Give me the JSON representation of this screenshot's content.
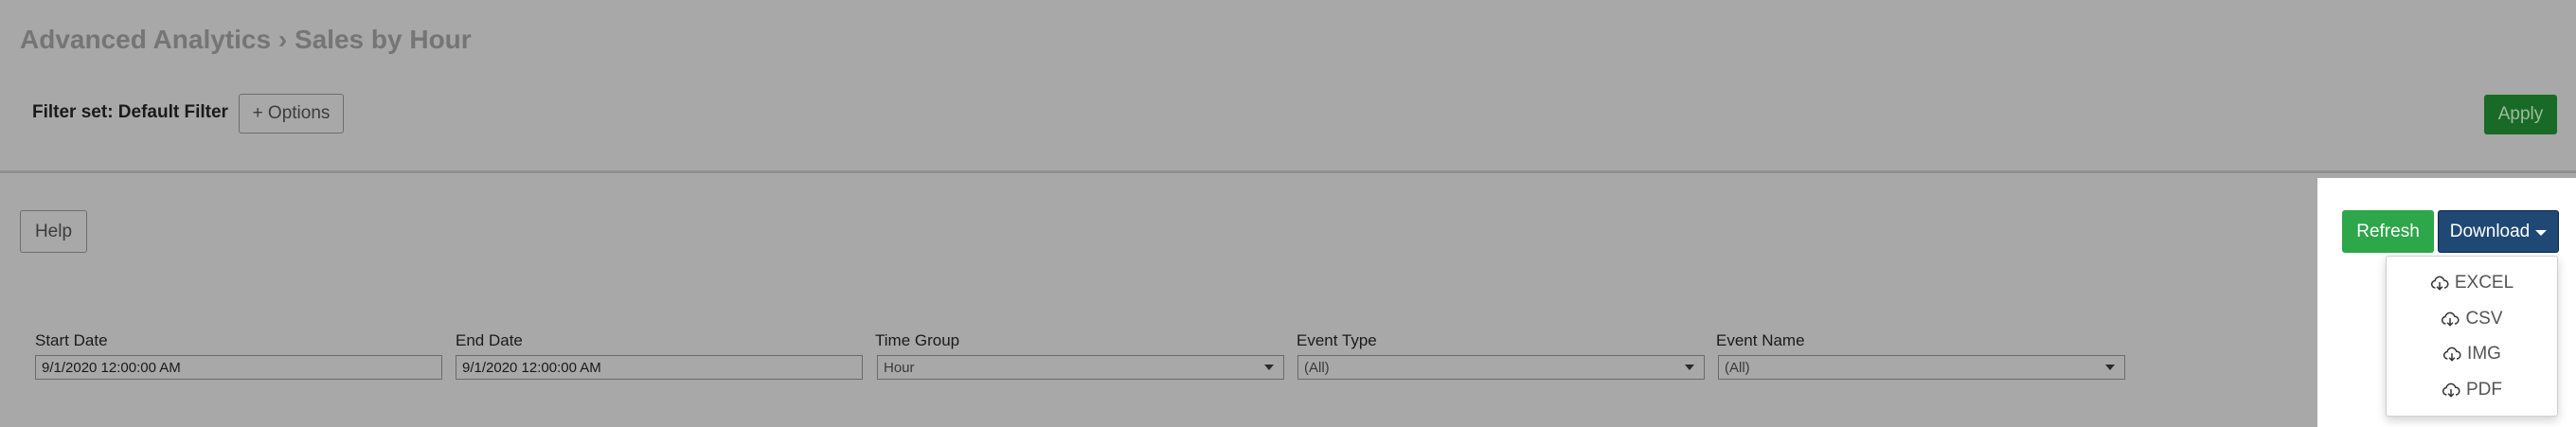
{
  "header": {
    "title": "Advanced Analytics › Sales by Hour"
  },
  "filter": {
    "label": "Filter set: Default Filter",
    "options_label": "+ Options",
    "apply_label": "Apply"
  },
  "toolbar": {
    "help_label": "Help",
    "refresh_label": "Refresh",
    "download_label": "Download"
  },
  "download_menu": {
    "items": [
      {
        "label": "EXCEL",
        "icon": "cloud-download-icon"
      },
      {
        "label": "CSV",
        "icon": "cloud-download-icon"
      },
      {
        "label": "IMG",
        "icon": "cloud-download-icon"
      },
      {
        "label": "PDF",
        "icon": "cloud-download-icon"
      }
    ]
  },
  "fields": {
    "start_date": {
      "label": "Start Date",
      "value": "9/1/2020 12:00:00 AM"
    },
    "end_date": {
      "label": "End Date",
      "value": "9/1/2020 12:00:00 AM"
    },
    "time_group": {
      "label": "Time Group",
      "value": "Hour"
    },
    "event_type": {
      "label": "Event Type",
      "value": "(All)"
    },
    "event_name": {
      "label": "Event Name",
      "value": "(All)"
    }
  },
  "colors": {
    "overlay_bg": "#a8a8a8",
    "apply": "#196a26",
    "refresh": "#2ea64a",
    "download": "#1f4874"
  }
}
